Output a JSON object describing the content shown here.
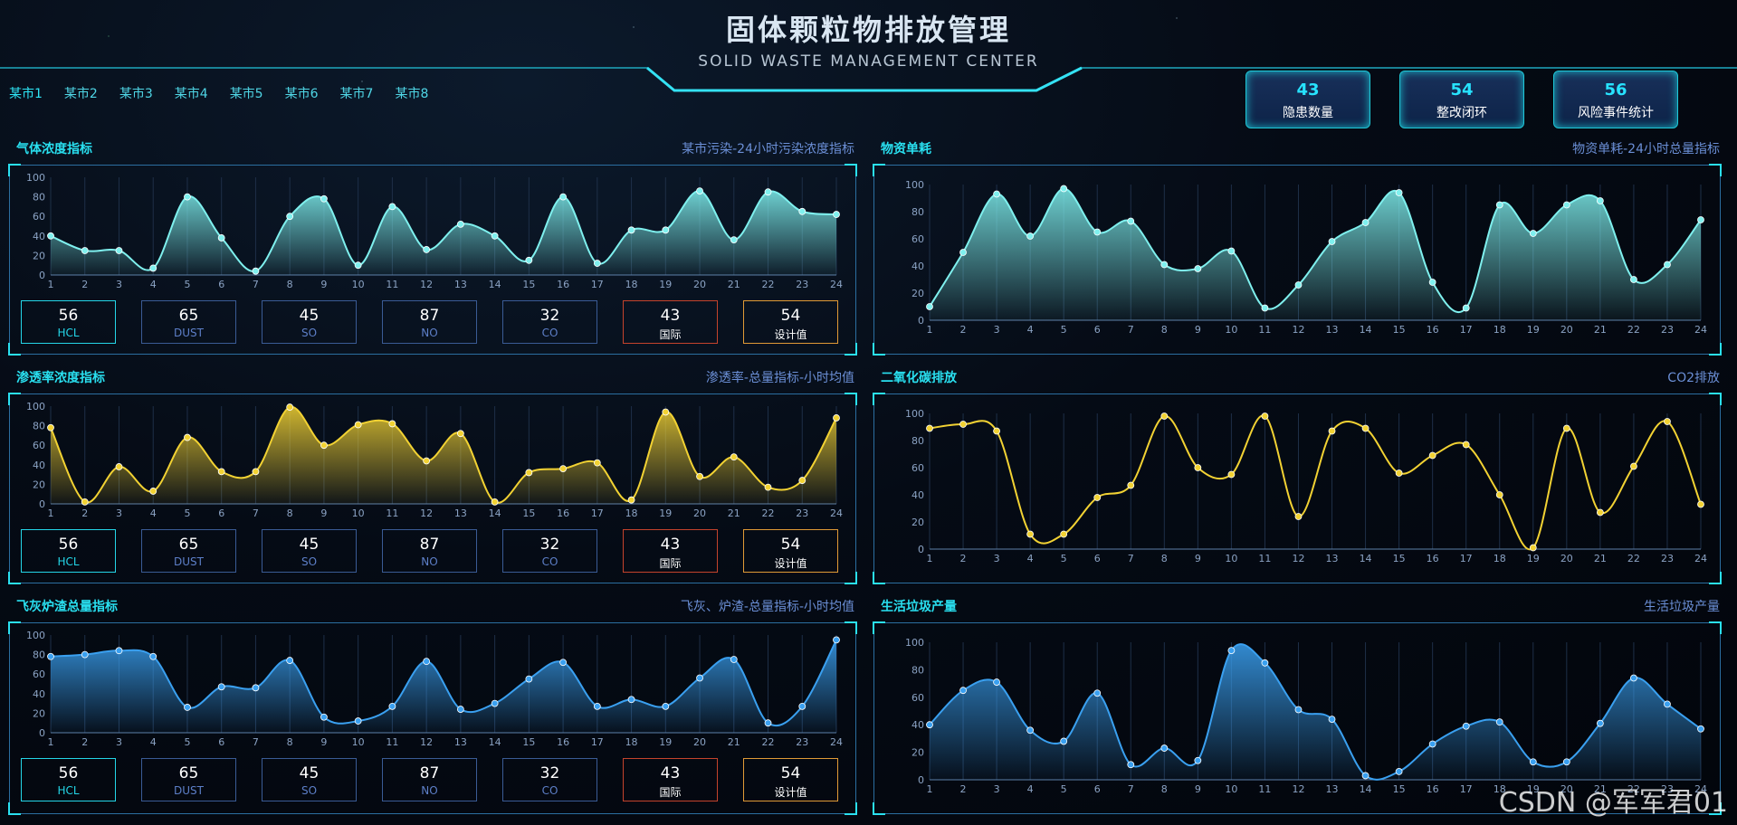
{
  "header": {
    "title": "固体颗粒物排放管理",
    "subtitle": "SOLID WASTE MANAGEMENT CENTER"
  },
  "city_tabs": [
    "某市1",
    "某市2",
    "某市3",
    "某市4",
    "某市5",
    "某市6",
    "某市7",
    "某市8"
  ],
  "stats": [
    {
      "value": "43",
      "label": "隐患数量"
    },
    {
      "value": "54",
      "label": "整改闭环"
    },
    {
      "value": "56",
      "label": "风险事件统计"
    }
  ],
  "panels": [
    {
      "title": "气体浓度指标",
      "subtitle": "某市污染-24小时污染浓度指标"
    },
    {
      "title": "物资单耗",
      "subtitle": "物资单耗-24小时总量指标"
    },
    {
      "title": "渗透率浓度指标",
      "subtitle": "渗透率-总量指标-小时均值"
    },
    {
      "title": "二氧化碳排放",
      "subtitle": "CO2排放"
    },
    {
      "title": "飞灰炉渣总量指标",
      "subtitle": "飞灰、炉渣-总量指标-小时均值"
    },
    {
      "title": "生活垃圾产量",
      "subtitle": "生活垃圾产量"
    }
  ],
  "metrics": [
    {
      "value": "56",
      "label": "HCL"
    },
    {
      "value": "65",
      "label": "DUST"
    },
    {
      "value": "45",
      "label": "SO"
    },
    {
      "value": "87",
      "label": "NO"
    },
    {
      "value": "32",
      "label": "CO"
    },
    {
      "value": "43",
      "label": "国际"
    },
    {
      "value": "54",
      "label": "设计值"
    }
  ],
  "watermark": "CSDN @军军君01",
  "colors": {
    "teal": "#7ff0ee",
    "yellow": "#f2d233",
    "blue": "#3aa0f0",
    "accent": "#29e0f0"
  },
  "chart_data": [
    {
      "type": "area",
      "panel": "气体浓度指标",
      "color": "#7ff0ee",
      "x": [
        1,
        2,
        3,
        4,
        5,
        6,
        7,
        8,
        9,
        10,
        11,
        12,
        13,
        14,
        15,
        16,
        17,
        18,
        19,
        20,
        21,
        22,
        23,
        24
      ],
      "ylim": [
        0,
        100
      ],
      "yticks": [
        0,
        20,
        40,
        60,
        80,
        100
      ],
      "values": [
        40,
        25,
        25,
        7,
        80,
        38,
        4,
        60,
        78,
        10,
        70,
        26,
        52,
        40,
        15,
        80,
        12,
        46,
        46,
        86,
        36,
        85,
        65,
        62
      ]
    },
    {
      "type": "area",
      "panel": "物资单耗",
      "color": "#7ff0ee",
      "x": [
        1,
        2,
        3,
        4,
        5,
        6,
        7,
        8,
        9,
        10,
        11,
        12,
        13,
        14,
        15,
        16,
        17,
        18,
        19,
        20,
        21,
        22,
        23,
        24
      ],
      "ylim": [
        0,
        100
      ],
      "yticks": [
        0,
        20,
        40,
        60,
        80,
        100
      ],
      "values": [
        10,
        50,
        93,
        62,
        97,
        65,
        73,
        41,
        38,
        51,
        9,
        26,
        58,
        72,
        94,
        28,
        9,
        85,
        64,
        85,
        88,
        30,
        41,
        74
      ]
    },
    {
      "type": "area",
      "panel": "渗透率浓度指标",
      "color": "#f2d233",
      "x": [
        1,
        2,
        3,
        4,
        5,
        6,
        7,
        8,
        9,
        10,
        11,
        12,
        13,
        14,
        15,
        16,
        17,
        18,
        19,
        20,
        21,
        22,
        23,
        24
      ],
      "ylim": [
        0,
        100
      ],
      "yticks": [
        0,
        20,
        40,
        60,
        80,
        100
      ],
      "values": [
        78,
        2,
        38,
        13,
        68,
        33,
        33,
        99,
        60,
        81,
        82,
        44,
        72,
        2,
        32,
        36,
        42,
        4,
        94,
        28,
        48,
        17,
        24,
        88
      ]
    },
    {
      "type": "line",
      "panel": "二氧化碳排放",
      "color": "#f2d233",
      "x": [
        1,
        2,
        3,
        4,
        5,
        6,
        7,
        8,
        9,
        10,
        11,
        12,
        13,
        14,
        15,
        16,
        17,
        18,
        19,
        20,
        21,
        22,
        23,
        24
      ],
      "ylim": [
        0,
        100
      ],
      "yticks": [
        0,
        20,
        40,
        60,
        80,
        100
      ],
      "values": [
        89,
        92,
        87,
        11,
        11,
        38,
        47,
        98,
        60,
        55,
        98,
        24,
        87,
        89,
        56,
        69,
        77,
        40,
        1,
        89,
        27,
        61,
        94,
        33
      ]
    },
    {
      "type": "area",
      "panel": "飞灰炉渣总量指标",
      "color": "#3aa0f0",
      "x": [
        1,
        2,
        3,
        4,
        5,
        6,
        7,
        8,
        9,
        10,
        11,
        12,
        13,
        14,
        15,
        16,
        17,
        18,
        19,
        20,
        21,
        22,
        23,
        24
      ],
      "ylim": [
        0,
        100
      ],
      "yticks": [
        0,
        20,
        40,
        60,
        80,
        100
      ],
      "values": [
        78,
        80,
        84,
        78,
        26,
        47,
        46,
        74,
        16,
        12,
        27,
        73,
        24,
        30,
        55,
        72,
        27,
        34,
        27,
        56,
        75,
        10,
        27,
        95
      ]
    },
    {
      "type": "area",
      "panel": "生活垃圾产量",
      "color": "#3aa0f0",
      "x": [
        1,
        2,
        3,
        4,
        5,
        6,
        7,
        8,
        9,
        10,
        11,
        12,
        13,
        14,
        15,
        16,
        17,
        18,
        19,
        20,
        21,
        22,
        23,
        24
      ],
      "ylim": [
        0,
        100
      ],
      "yticks": [
        0,
        20,
        40,
        60,
        80,
        100
      ],
      "values": [
        40,
        65,
        71,
        36,
        28,
        63,
        11,
        23,
        14,
        94,
        85,
        51,
        44,
        3,
        6,
        26,
        39,
        42,
        13,
        13,
        41,
        74,
        55,
        37
      ]
    }
  ]
}
